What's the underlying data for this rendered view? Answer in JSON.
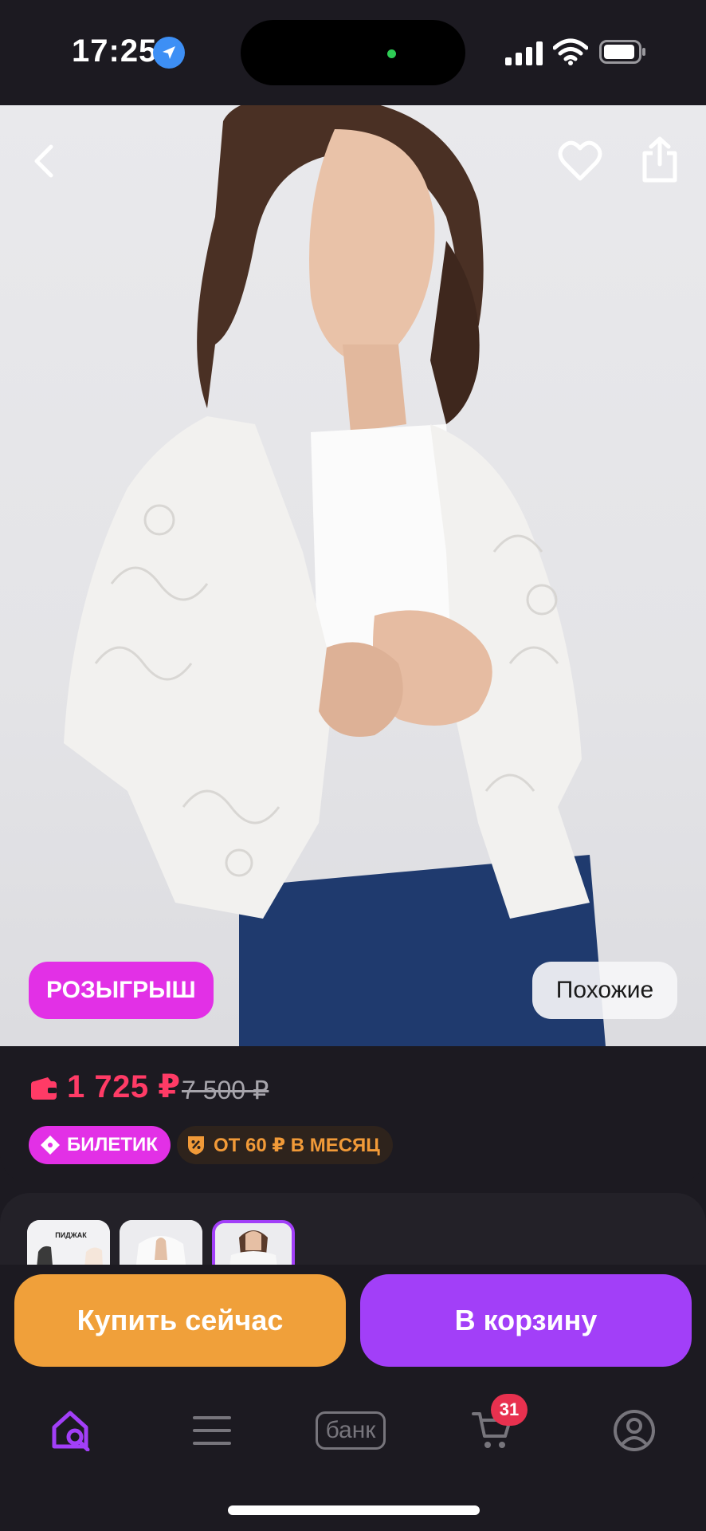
{
  "status_bar": {
    "time": "17:25",
    "icons": [
      "location-arrow-icon",
      "cellular-signal-icon",
      "wifi-icon",
      "battery-icon"
    ]
  },
  "product": {
    "image_badge": "РОЗЫГРЫШ",
    "similar_button": "Похожие",
    "price": "1 725 ₽",
    "old_price": "7 500 ₽",
    "ticket_badge": "БИЛЕТИК",
    "installment_badge": "ОТ 60 ₽ В МЕСЯЦ",
    "thumbnail_1_text": "ПИДЖАК"
  },
  "actions": {
    "buy_now": "Купить сейчас",
    "add_to_cart": "В корзину"
  },
  "tab_bar": {
    "bank_label": "банк",
    "cart_count": "31"
  },
  "colors": {
    "background": "#1c1a21",
    "price": "#ff3b66",
    "accent_purple": "#a23ff8",
    "accent_pink": "#e230e6",
    "accent_orange": "#f0a03a",
    "badge_red": "#e8314f"
  }
}
